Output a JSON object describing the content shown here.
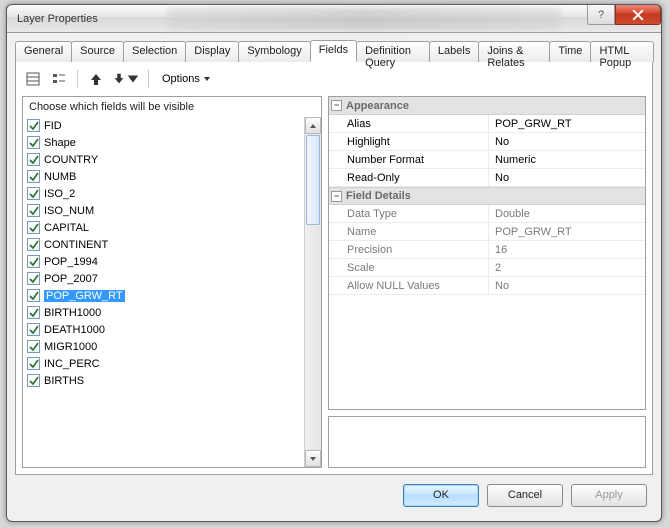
{
  "window": {
    "title": "Layer Properties"
  },
  "tabs": [
    {
      "label": "General"
    },
    {
      "label": "Source"
    },
    {
      "label": "Selection"
    },
    {
      "label": "Display"
    },
    {
      "label": "Symbology"
    },
    {
      "label": "Fields",
      "active": true
    },
    {
      "label": "Definition Query"
    },
    {
      "label": "Labels"
    },
    {
      "label": "Joins & Relates"
    },
    {
      "label": "Time"
    },
    {
      "label": "HTML Popup"
    }
  ],
  "toolbar": {
    "options_label": "Options"
  },
  "fieldlist": {
    "heading": "Choose which fields will be visible",
    "items": [
      {
        "label": "FID",
        "checked": true
      },
      {
        "label": "Shape",
        "checked": true
      },
      {
        "label": "COUNTRY",
        "checked": true
      },
      {
        "label": "NUMB",
        "checked": true
      },
      {
        "label": "ISO_2",
        "checked": true
      },
      {
        "label": "ISO_NUM",
        "checked": true
      },
      {
        "label": "CAPITAL",
        "checked": true
      },
      {
        "label": "CONTINENT",
        "checked": true
      },
      {
        "label": "POP_1994",
        "checked": true
      },
      {
        "label": "POP_2007",
        "checked": true
      },
      {
        "label": "POP_GRW_RT",
        "checked": true,
        "selected": true
      },
      {
        "label": "BIRTH1000",
        "checked": true
      },
      {
        "label": "DEATH1000",
        "checked": true
      },
      {
        "label": "MIGR1000",
        "checked": true
      },
      {
        "label": "INC_PERC",
        "checked": true
      },
      {
        "label": "BIRTHS",
        "checked": true
      }
    ]
  },
  "propgrid": {
    "sections": [
      {
        "title": "Appearance",
        "rows": [
          {
            "k": "Alias",
            "v": "POP_GRW_RT",
            "ro": false
          },
          {
            "k": "Highlight",
            "v": "No",
            "ro": false
          },
          {
            "k": "Number Format",
            "v": "Numeric",
            "ro": false
          },
          {
            "k": "Read-Only",
            "v": "No",
            "ro": false
          }
        ]
      },
      {
        "title": "Field Details",
        "rows": [
          {
            "k": "Data Type",
            "v": "Double",
            "ro": true
          },
          {
            "k": "Name",
            "v": "POP_GRW_RT",
            "ro": true
          },
          {
            "k": "Precision",
            "v": "16",
            "ro": true
          },
          {
            "k": "Scale",
            "v": "2",
            "ro": true
          },
          {
            "k": "Allow NULL Values",
            "v": "No",
            "ro": true
          }
        ]
      }
    ]
  },
  "buttons": {
    "ok": "OK",
    "cancel": "Cancel",
    "apply": "Apply"
  }
}
